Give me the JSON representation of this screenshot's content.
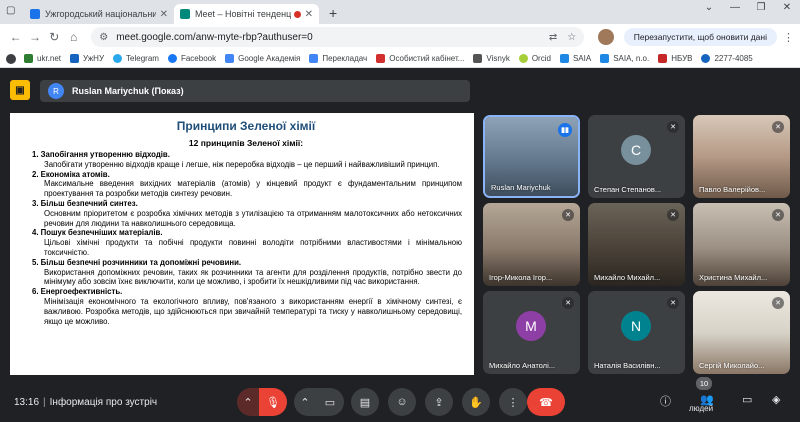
{
  "browser": {
    "tabs": [
      {
        "label": "Ужгородський національний",
        "favicon_color": "#1a73e8"
      },
      {
        "label": "Meet – Новітні тенденції з",
        "favicon_color": "#00897b"
      }
    ],
    "url": "meet.google.com/anw-myte-rbp?authuser=0",
    "restart_label": "Перезапустити, щоб оновити дані",
    "bookmarks": [
      {
        "label": "ukr.net",
        "color": "#2e7d32"
      },
      {
        "label": "УжНУ",
        "color": "#1565c0"
      },
      {
        "label": "Telegram",
        "color": "#29a9eb"
      },
      {
        "label": "Facebook",
        "color": "#1877f2"
      },
      {
        "label": "Google Академія",
        "color": "#4285f4"
      },
      {
        "label": "Перекладач",
        "color": "#4285f4"
      },
      {
        "label": "Особистий кабінет...",
        "color": "#d32f2f"
      },
      {
        "label": "Visnyk",
        "color": "#555555"
      },
      {
        "label": "Orcid",
        "color": "#a6ce39"
      },
      {
        "label": "SAIA",
        "color": "#1e88e5"
      },
      {
        "label": "SAIA, n.o.",
        "color": "#1e88e5"
      },
      {
        "label": "НБУВ",
        "color": "#c62828"
      },
      {
        "label": "2277-4085",
        "color": "#1565c0"
      }
    ]
  },
  "meet": {
    "presenter": {
      "initial": "R",
      "name": "Ruslan Mariychuk (Показ)"
    },
    "document": {
      "title": "Принципи Зеленої хімії",
      "subtitle": "12 принципів Зеленої хімії:",
      "principles": [
        {
          "heading": "1.  Запобігання утворенню відходів.",
          "body": "Запобігати утворенню відходів краще і легше, ніж переробка відходів – це перший і найважливіший принцип."
        },
        {
          "heading": "2.  Економіка атомів.",
          "body": "Максимальне введення вихідних матеріалів (атомів) у кінцевий продукт є фундаментальним принципом проектування та розробки методів синтезу речовин."
        },
        {
          "heading": "3.  Більш безпечний синтез.",
          "body": "Основним пріоритетом є розробка хімічних методів з утилізацією та отриманням малотоксичних або нетоксичних речовин для людини та навколишнього середовища."
        },
        {
          "heading": "4.  Пошук безпечніших матеріалів.",
          "body": "Цільові хімічні продукти та побічні продукти повинні володіти потрібними властивостями і мінімальною токсичністю."
        },
        {
          "heading": "5.  Більш безпечні розчинники та допоміжні речовини.",
          "body": "Використання допоміжних речовин, таких як розчинники та агенти для розділення продуктів, потрібно звести до мінімуму або зовсім їхнє виключити, коли це можливо, і зробити їх нешкідливими під час використання."
        },
        {
          "heading": "6.  Енергоефективність.",
          "body": "Мінімізація економічного та екологічного впливу, пов'язаного з використанням енергії в хімічному синтезі, є важливою. Розробка методів, що здійснюються при звичайній температурі та тиску у навколишньому середовищі, якщо це можливо."
        }
      ]
    },
    "participants": [
      {
        "name": "Ruslan Mariychuk",
        "type": "video",
        "bg": "#6b7f95",
        "speaking": true
      },
      {
        "name": "Степан Степанов...",
        "type": "letter",
        "letter": "C",
        "avatar_color": "#78909c"
      },
      {
        "name": "Павло Валерійов...",
        "type": "video",
        "bg": "#b59a86"
      },
      {
        "name": "Ігор-Микола Ігор...",
        "type": "video",
        "bg": "#8a7a6c"
      },
      {
        "name": "Михайло Михайл...",
        "type": "video",
        "bg": "#4a4238"
      },
      {
        "name": "Христина Михайл...",
        "type": "video",
        "bg": "#9a8f82"
      },
      {
        "name": "Михайло Анатолі...",
        "type": "letter",
        "letter": "M",
        "avatar_color": "#8e3fa5"
      },
      {
        "name": "Наталія Василівн...",
        "type": "letter",
        "letter": "N",
        "avatar_color": "#00838f"
      },
      {
        "name": "Сергій Миколайо...",
        "type": "video",
        "bg": "#d8d3c8"
      }
    ],
    "people_count": "10",
    "people_label": "людей",
    "time": "13:16",
    "meeting_info": "Інформація про зустріч"
  }
}
